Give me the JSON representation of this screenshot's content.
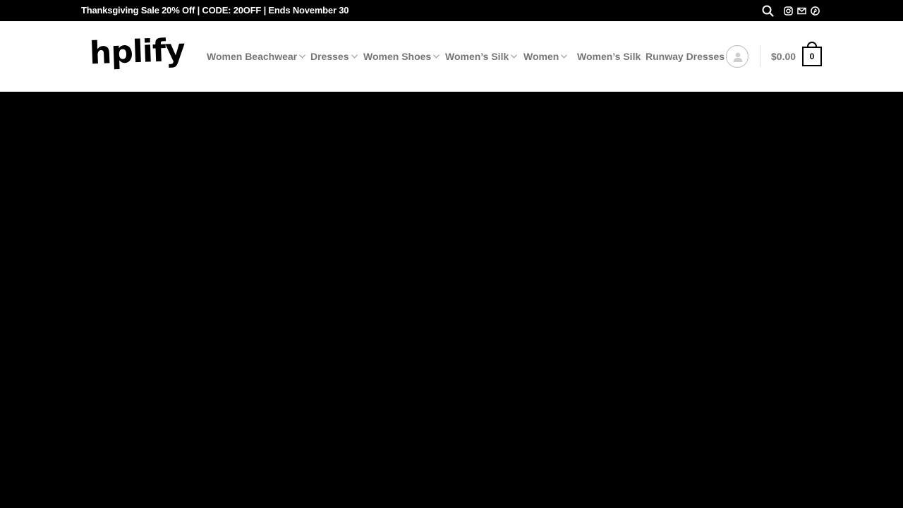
{
  "topbar": {
    "promo_text": "Thanksgiving Sale 20% Off | CODE: 20OFF | Ends November 30",
    "icons": [
      "search-icon",
      "instagram-icon",
      "email-icon",
      "pinterest-icon"
    ]
  },
  "header": {
    "logo_text": "hplify",
    "nav": [
      {
        "label": "Women Beachwear",
        "has_dropdown": true
      },
      {
        "label": "Dresses",
        "has_dropdown": true
      },
      {
        "label": "Women Shoes",
        "has_dropdown": true
      },
      {
        "label": "Women’s Silk",
        "has_dropdown": true
      },
      {
        "label": "Women",
        "has_dropdown": true
      },
      {
        "label": "Women’s Silk",
        "has_dropdown": false
      },
      {
        "label": "Runway Dresses",
        "has_dropdown": false
      }
    ],
    "cart_total": "$0.00",
    "cart_count": "0"
  },
  "colors": {
    "topbar_bg": "#000000",
    "header_bg": "#ffffff",
    "nav_text": "#767676",
    "hero_bg": "#000000"
  }
}
